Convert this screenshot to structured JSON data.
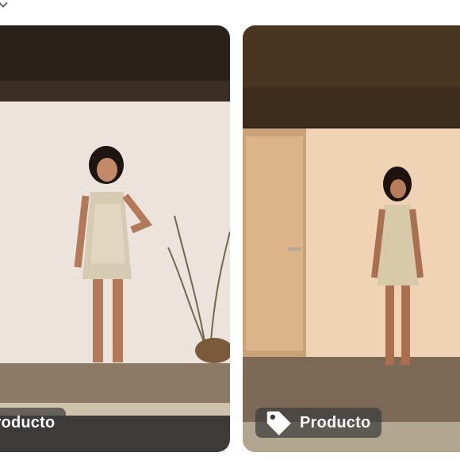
{
  "gallery": {
    "items": [
      {
        "tag_label": "Producto",
        "tag_icon": "price-tag-icon",
        "image": "woman-sequin-dress-white-wall"
      },
      {
        "tag_label": "Producto",
        "tag_icon": "price-tag-icon",
        "image": "woman-sequin-dress-peach-door"
      }
    ]
  },
  "colors": {
    "tag_background": "#3c3c3cb8",
    "tag_text": "#ffffff"
  }
}
